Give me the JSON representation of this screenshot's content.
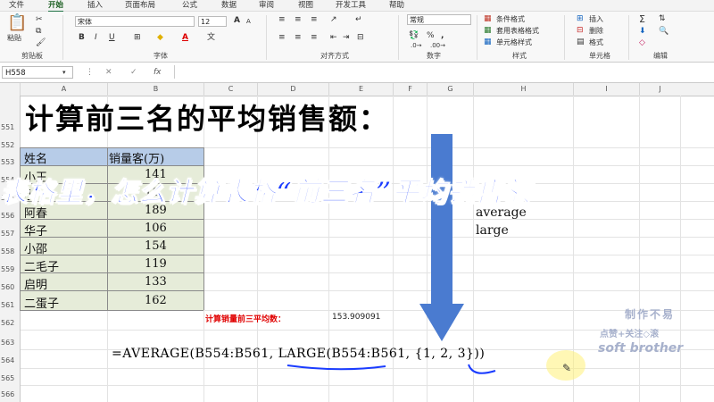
{
  "tabs": [
    "文件",
    "开始",
    "插入",
    "页面布局",
    "公式",
    "数据",
    "审阅",
    "视图",
    "开发工具",
    "帮助"
  ],
  "active_tab": "开始",
  "ribbon": {
    "clipboard": {
      "paste_label": "粘贴",
      "group_label": "剪贴板"
    },
    "font": {
      "name": "宋体",
      "size": "12",
      "bold": "B",
      "italic": "I",
      "underline": "U",
      "group_label": "字体",
      "grow": "A",
      "shrink": "A"
    },
    "alignment": {
      "group_label": "对齐方式"
    },
    "number": {
      "format": "常规",
      "percent": "%",
      "comma": ",",
      "group_label": "数字"
    },
    "styles": {
      "conditional": "条件格式",
      "table_format": "套用表格格式",
      "cell_styles": "单元格样式",
      "group_label": "样式"
    },
    "cells": {
      "insert": "插入",
      "delete": "删除",
      "format": "格式",
      "group_label": "单元格"
    },
    "editing": {
      "sum": "Σ",
      "group_label": "编辑"
    }
  },
  "formula_bar": {
    "name_box": "H558",
    "cancel": "✕",
    "enter": "✓",
    "fx": "fx"
  },
  "columns": [
    "A",
    "B",
    "C",
    "D",
    "E",
    "F",
    "G",
    "H",
    "I",
    "J"
  ],
  "rows": [
    "551",
    "552",
    "553",
    "554",
    "555",
    "556",
    "557",
    "558",
    "559",
    "560",
    "561",
    "562",
    "563",
    "564",
    "565",
    "566"
  ],
  "heading": "计算前三名的平均销售额：",
  "overlay_title": "表格里，怎么计算表格“前三名”平均销售额",
  "table": {
    "headers": [
      "姓名",
      "销量客(万)"
    ],
    "rows": [
      {
        "name": "小王",
        "value": "141"
      },
      {
        "name": "小",
        "value": "16"
      },
      {
        "name": "阿春",
        "value": "189"
      },
      {
        "name": "华子",
        "value": "106"
      },
      {
        "name": "小邵",
        "value": "154"
      },
      {
        "name": "二毛子",
        "value": "119"
      },
      {
        "name": "启明",
        "value": "133"
      },
      {
        "name": "二蛋子",
        "value": "162"
      }
    ]
  },
  "side_words": [
    "average",
    "large"
  ],
  "result_label": "计算销量前三平均数：",
  "result_value": "153.909091",
  "formula": "=AVERAGE(B554:B561, LARGE(B554:B561, {1, 2, 3}))",
  "watermark": [
    "制作不易",
    "点赞+关注◇滚",
    "soft brother"
  ],
  "colors": {
    "overlay_text": "#1a3cff",
    "arrow": "#4a7bd0",
    "table_body": "#e6ecd9",
    "table_header": "#b7cce8",
    "result_label": "#e00000",
    "underline": "#1a3cff",
    "excel_green": "#217346"
  }
}
